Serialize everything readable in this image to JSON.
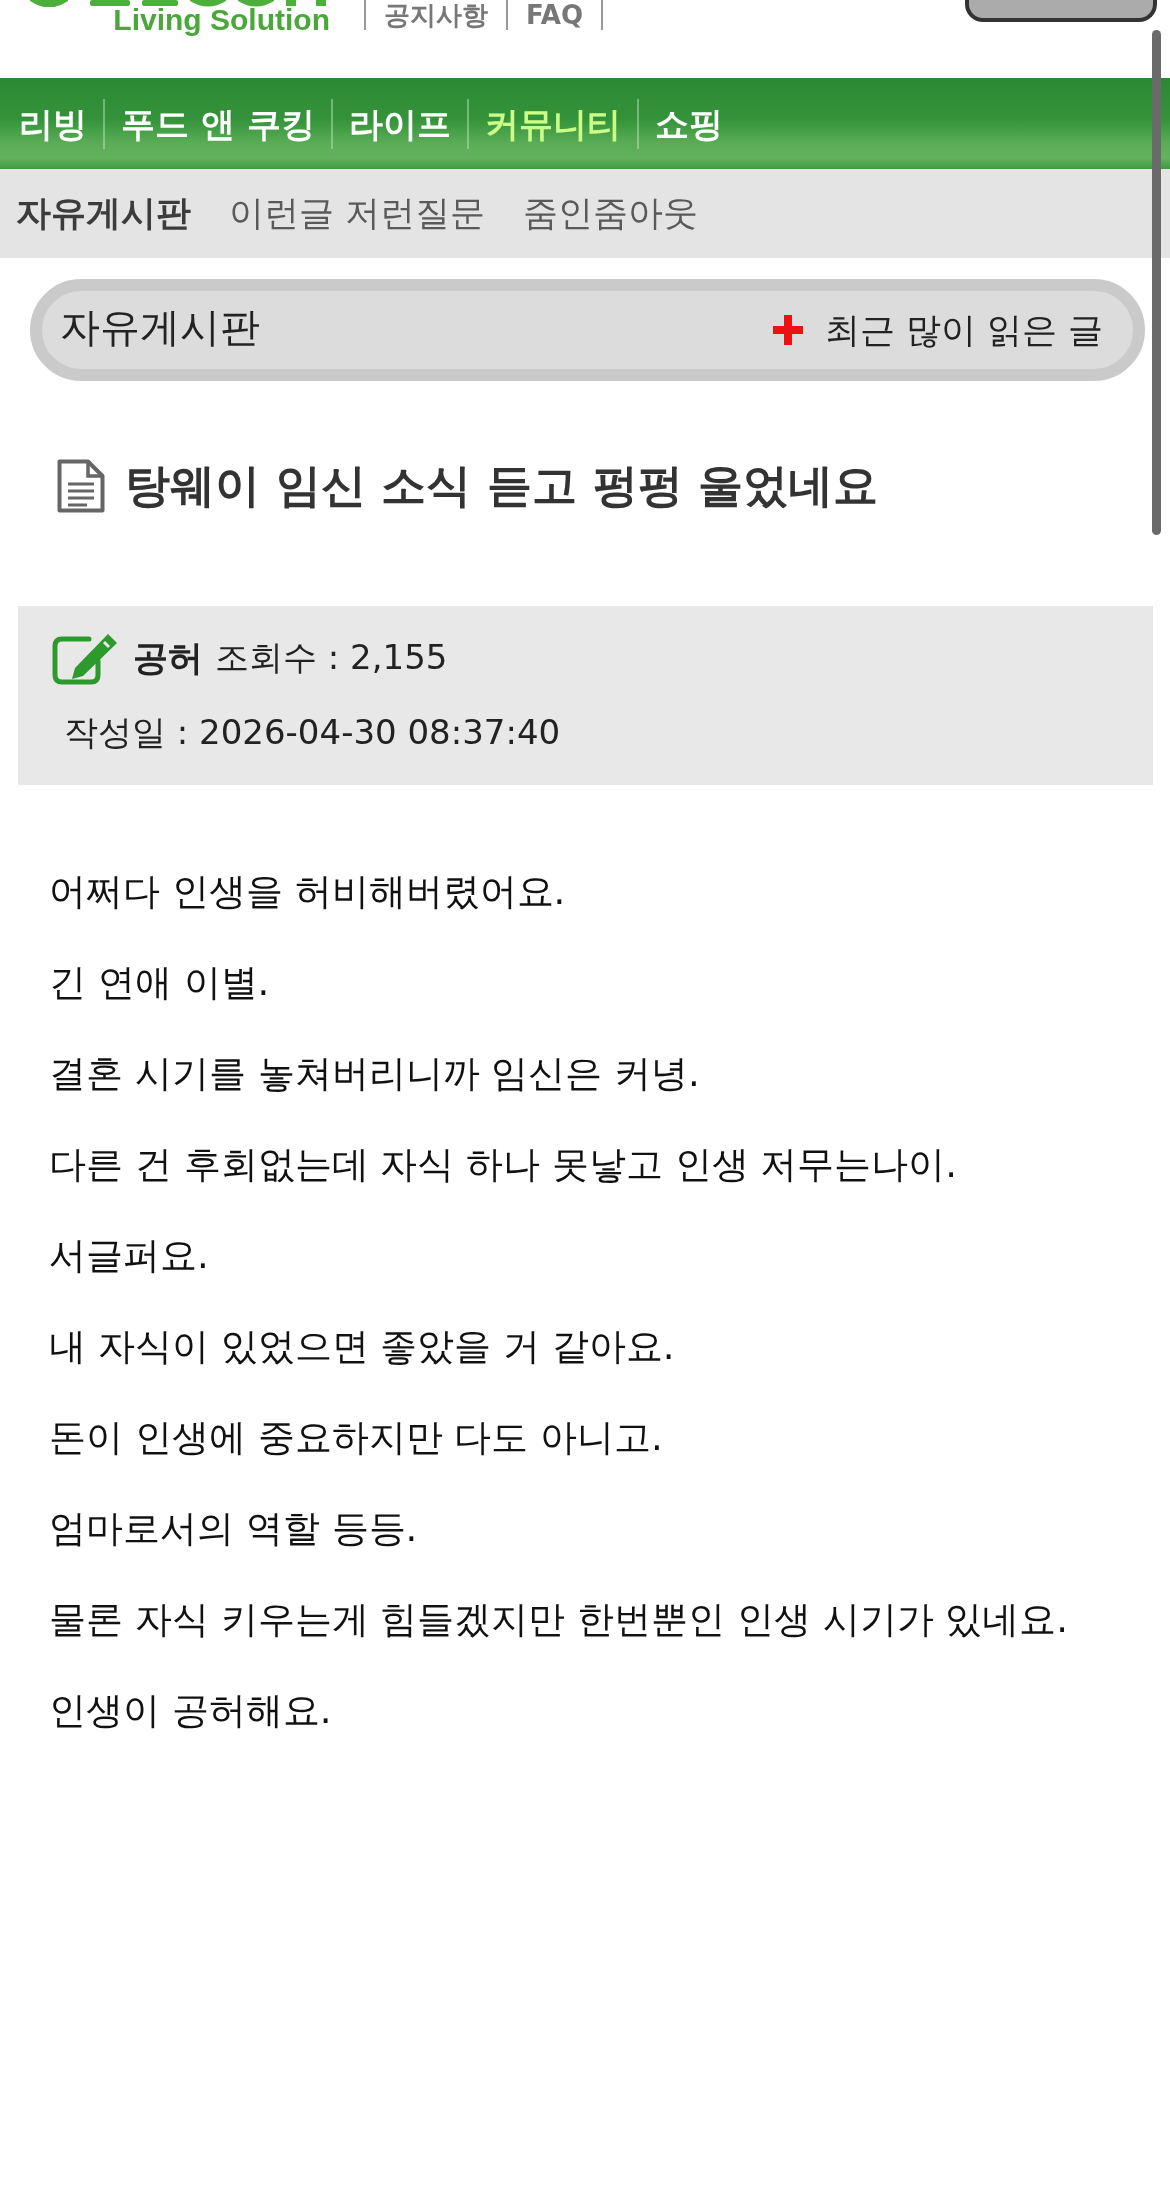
{
  "header": {
    "logo_tagline": "Living Solution",
    "links": [
      "공지사항",
      "FAQ"
    ]
  },
  "main_nav": [
    {
      "label": "리빙",
      "selected": false
    },
    {
      "label": "푸드 앤 쿠킹",
      "selected": false
    },
    {
      "label": "라이프",
      "selected": false
    },
    {
      "label": "커뮤니티",
      "selected": true
    },
    {
      "label": "쇼핑",
      "selected": false
    }
  ],
  "sub_nav": [
    {
      "label": "자유게시판",
      "selected": true
    },
    {
      "label": "이런글 저런질문",
      "selected": false
    },
    {
      "label": "줌인줌아웃",
      "selected": false
    }
  ],
  "board_header": {
    "title": "자유게시판",
    "popular_link": "최근 많이 읽은 글"
  },
  "post": {
    "title": "탕웨이 임신 소식 듣고 펑펑 울었네요",
    "author": "공허",
    "views": "조회수 : 2,155",
    "date": "작성일 : 2026-04-30 08:37:40",
    "body": [
      "어쩌다 인생을 허비해버렸어요.",
      "긴 연애 이별.",
      "결혼 시기를 놓쳐버리니까 임신은 커녕.",
      "다른 건 후회없는데 자식 하나 못낳고 인생 저무는나이.",
      "서글퍼요.",
      "내 자식이 있었으면 좋았을 거 같아요.",
      "돈이 인생에 중요하지만 다도 아니고.",
      "엄마로서의 역할 등등.",
      "물론 자식 키우는게 힘들겠지만 한번뿐인 인생 시기가 있네요.",
      "인생이 공허해요."
    ]
  }
}
